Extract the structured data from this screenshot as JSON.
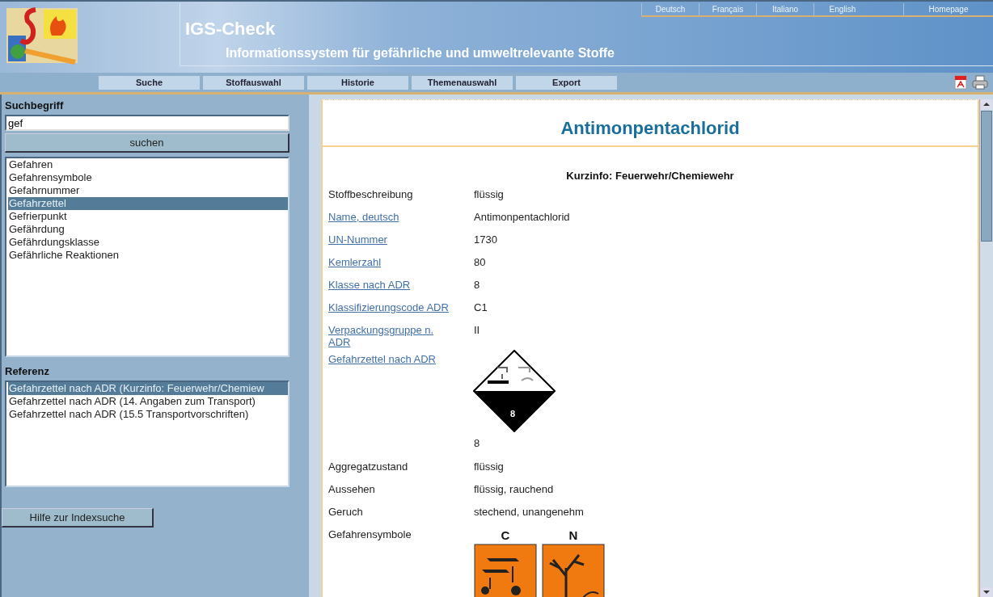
{
  "header": {
    "title": "IGS-Check",
    "subtitle": "Informationssystem für gefährliche und umweltrelevante Stoffe",
    "languages": [
      "Deutsch",
      "Français",
      "Italiano",
      "English"
    ],
    "homepage": "Homepage"
  },
  "nav": [
    "Suche",
    "Stoffauswahl",
    "Historie",
    "Themenauswahl",
    "Export"
  ],
  "search": {
    "label": "Suchbegriff",
    "value": "gef",
    "button": "suchen",
    "results": [
      {
        "text": "Gefahren",
        "selected": false
      },
      {
        "text": "Gefahrensymbole",
        "selected": false
      },
      {
        "text": "Gefahrnummer",
        "selected": false
      },
      {
        "text": "Gefahrzettel",
        "selected": true
      },
      {
        "text": "Gefrierpunkt",
        "selected": false
      },
      {
        "text": "Gefährdung",
        "selected": false
      },
      {
        "text": "Gefährdungsklasse",
        "selected": false
      },
      {
        "text": "Gefährliche Reaktionen",
        "selected": false
      }
    ]
  },
  "reference": {
    "label": "Referenz",
    "items": [
      {
        "text": "Gefahrzettel nach ADR (Kurzinfo: Feuerwehr/Chemiew",
        "selected": true
      },
      {
        "text": "Gefahrzettel nach ADR (14. Angaben zum Transport)",
        "selected": false
      },
      {
        "text": "Gefahrzettel nach ADR (15.5 Transportvorschriften)",
        "selected": false
      }
    ]
  },
  "help_button": "Hilfe zur Indexsuche",
  "substance": {
    "title": "Antimonpentachlorid",
    "section": "Kurzinfo: Feuerwehr/Chemiewehr",
    "rows": [
      {
        "kind": "text",
        "label": "Stoffbeschreibung",
        "link": false,
        "value": "flüssig"
      },
      {
        "kind": "text",
        "label": "Name, deutsch",
        "link": true,
        "value": "Antimonpentachlorid"
      },
      {
        "kind": "text",
        "label": "UN-Nummer",
        "link": true,
        "value": "1730"
      },
      {
        "kind": "text",
        "label": "Kemlerzahl",
        "link": true,
        "value": "80"
      },
      {
        "kind": "text",
        "label": "Klasse nach ADR",
        "link": true,
        "value": "8"
      },
      {
        "kind": "text",
        "label": "Klassifizierungscode ADR",
        "link": true,
        "value": "C1"
      },
      {
        "kind": "text",
        "label": "Verpackungsgruppe n. ADR",
        "link": true,
        "value": "II"
      },
      {
        "kind": "diamond",
        "label": "Gefahrzettel nach ADR",
        "link": true,
        "diamond_number": "8",
        "value": "8"
      },
      {
        "kind": "text",
        "label": "Aggregatzustand",
        "link": false,
        "value": "flüssig"
      },
      {
        "kind": "text",
        "label": "Aussehen",
        "link": false,
        "value": "flüssig, rauchend"
      },
      {
        "kind": "text",
        "label": "Geruch",
        "link": false,
        "value": "stechend, unangenehm"
      },
      {
        "kind": "symbols",
        "label": "Gefahrensymbole",
        "link": false,
        "symbols": [
          {
            "letter": "C",
            "kind": "corrosive"
          },
          {
            "letter": "N",
            "kind": "environment"
          }
        ]
      }
    ]
  }
}
